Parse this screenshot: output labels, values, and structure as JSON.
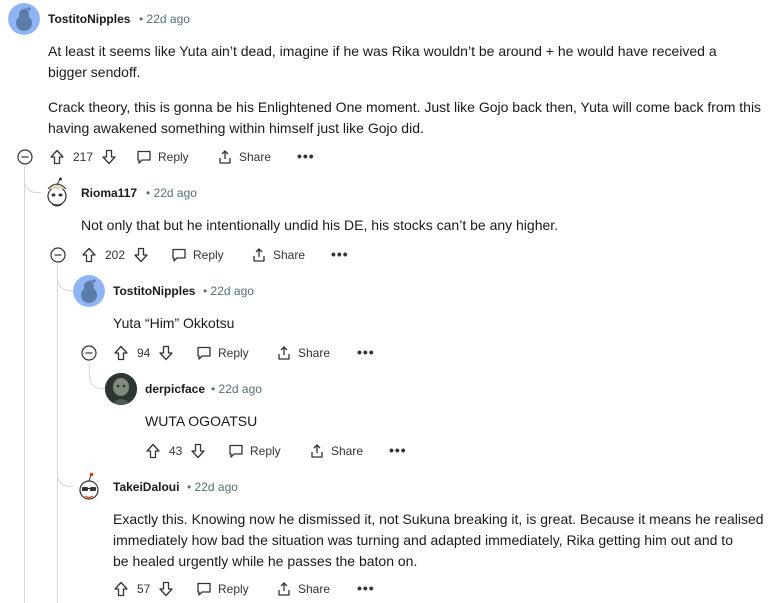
{
  "comments": [
    {
      "username": "TostitoNipples",
      "time": "• 22d ago",
      "paragraphs": [
        "At least it seems like Yuta ain’t dead, imagine if he was Rika wouldn’t be around + he would have received a",
        "bigger sendoff.",
        "Crack theory, this is gonna be his Enlightened One moment. Just like Gojo back then, Yuta will come back from this",
        "having awakened something within himself just like Gojo did."
      ],
      "votes": "217",
      "reply": "Reply",
      "share": "Share",
      "more": "•••"
    },
    {
      "username": "Rioma117",
      "time": "• 22d ago",
      "paragraphs": [
        "Not only that but he intentionally undid his DE, his stocks can’t be any higher."
      ],
      "votes": "202",
      "reply": "Reply",
      "share": "Share",
      "more": "•••"
    },
    {
      "username": "TostitoNipples",
      "time": "• 22d ago",
      "paragraphs": [
        "Yuta “Him” Okkotsu"
      ],
      "votes": "94",
      "reply": "Reply",
      "share": "Share",
      "more": "•••"
    },
    {
      "username": "derpicface",
      "time": "• 22d ago",
      "paragraphs": [
        "WUTA OGOATSU"
      ],
      "votes": "43",
      "reply": "Reply",
      "share": "Share",
      "more": "•••"
    },
    {
      "username": "TakeiDaloui",
      "time": "• 22d ago",
      "paragraphs": [
        "Exactly this. Knowing now he dismissed it, not Sukuna breaking it, is great. Because it means he realised",
        "immediately how bad the situation was turning and adapted immediately, Rika getting him out and to",
        "be healed urgently while he passes the baton on."
      ],
      "votes": "57",
      "reply": "Reply",
      "share": "Share",
      "more": "•••"
    }
  ],
  "icons": {
    "upvote": "upvote-arrow-icon",
    "downvote": "downvote-arrow-icon",
    "reply": "speech-bubble-icon",
    "share": "share-icon",
    "collapse": "collapse-minus-icon"
  },
  "colors": {
    "time": "#576f76",
    "thread_line": "#d5d8da",
    "avatar_blue": "#8fb4f5"
  }
}
